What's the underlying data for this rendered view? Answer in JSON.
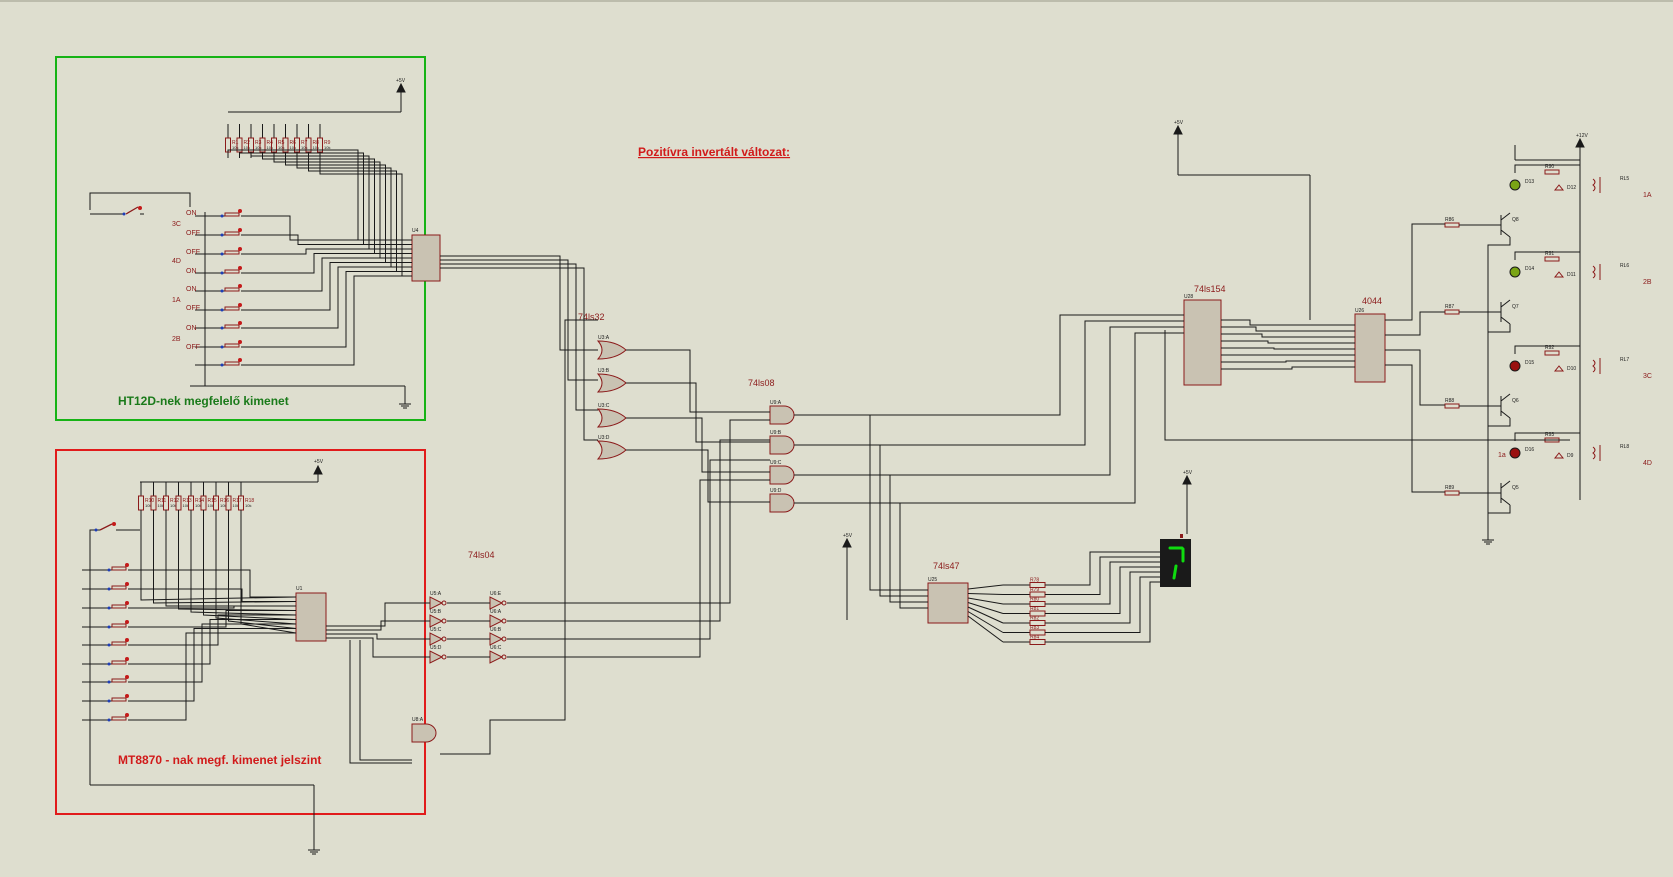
{
  "title": "Pozitívra invertált változat:",
  "blocks": {
    "green_label": "HT12D-nek megfelelő kimenet",
    "red_label": "MT8870 - nak megf. kimenet jelszint"
  },
  "chips": {
    "ls32": "74ls32",
    "ls08": "74ls08",
    "ls04": "74ls04",
    "ls47": "74ls47",
    "ls154": "74ls154",
    "c4044": "4044"
  },
  "refs": {
    "u4": "U4",
    "u1": "U1",
    "u25": "U25",
    "u28": "U28",
    "u26": "U26",
    "u3a": "U3:A",
    "u3b": "U3:B",
    "u3c": "U3:C",
    "u3d": "U3:D",
    "u5a": "U5:A",
    "u5b": "U5:B",
    "u5c": "U5:C",
    "u5d": "U5:D",
    "u6a": "U6:A",
    "u6b": "U6:B",
    "u6c": "U6:C",
    "u6d": "U6:D",
    "u9a": "U9:A",
    "u9b": "U9:B",
    "u9c": "U9:C",
    "u9d": "U9:D",
    "u6e": "U6:E",
    "u8a": "U8:A"
  },
  "switch_labels": [
    {
      "code": "3C",
      "on": "ON",
      "off": "OFF"
    },
    {
      "code": "4D",
      "on": "ON",
      "off": "OFF"
    },
    {
      "code": "1A",
      "on": "ON",
      "off": "OFF"
    },
    {
      "code": "2B",
      "on": "ON",
      "off": "OFF"
    }
  ],
  "switch_label_texts": [
    "ON",
    "3C",
    "OFF",
    "OFF",
    "4D",
    "ON",
    "ON",
    "1A",
    "OFF",
    "ON",
    "2B",
    "OFF"
  ],
  "res_top": [
    "R1",
    "R2",
    "R3",
    "R4",
    "R5",
    "R6",
    "R7",
    "R8",
    "R9"
  ],
  "res_bottom": [
    "R10",
    "R11",
    "R12",
    "R13",
    "R14",
    "R15",
    "R16",
    "R17",
    "R18"
  ],
  "res_value": "10k",
  "power_labels": [
    "+5V",
    "+5V",
    "+5V",
    "+5V",
    "+5V",
    "+12V"
  ],
  "seg_resistors": [
    "R78",
    "R79",
    "R80",
    "R81",
    "R82",
    "R83",
    "R84"
  ],
  "relay_stages": [
    {
      "led": "D13",
      "diode": "D12",
      "relay": "RL5",
      "channel": "1A",
      "res_c": "R90",
      "res_b": "R86",
      "tr": "Q8"
    },
    {
      "led": "D14",
      "diode": "D11",
      "relay": "RL6",
      "channel": "2B",
      "res_c": "R91",
      "res_b": "R87",
      "tr": "Q7"
    },
    {
      "led": "D15",
      "diode": "D10",
      "relay": "RL7",
      "channel": "3C",
      "res_c": "R92",
      "res_b": "R88",
      "tr": "Q6"
    },
    {
      "led": "D16",
      "diode": "D9",
      "relay": "RL8",
      "channel": "4D",
      "res_c": "R93",
      "res_b": "R89",
      "tr": "Q5",
      "extra": "1a"
    }
  ],
  "colors": {
    "wire": "#1a1a1a",
    "component": "#8b1a1a",
    "chip_fill": "#c9c2b2",
    "green_box": "#16b316",
    "red_box": "#e11b1b",
    "green_text": "#1a7a1a",
    "title_text": "#d11a1a",
    "seg_on": "#0fdc0f",
    "led_green": "#7aa515",
    "led_red": "#9a1010",
    "background": "#dedecf"
  }
}
